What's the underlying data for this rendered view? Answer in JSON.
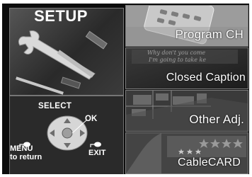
{
  "setup": {
    "title": "SETUP",
    "select_label": "SELECT",
    "ok_label": "OK",
    "menu_label": "MENU",
    "menu_sublabel": "to return",
    "exit_label": "EXIT"
  },
  "menu_items": [
    {
      "label": "Program CH",
      "icon": "remote-control-icon"
    },
    {
      "label": "Closed Caption",
      "icon": "caption-text-icon",
      "background_text": [
        "Why don't you come",
        "I'm going to take ke"
      ]
    },
    {
      "label": "Other Adj.",
      "icon": "circuit-board-icon"
    },
    {
      "label": "CableCARD",
      "icon": "cable-card-icon"
    }
  ],
  "colors": {
    "background": "#0c0c0c",
    "panel_gray": "#555555",
    "text": "#ffffff",
    "border": "#7a7a7a"
  }
}
